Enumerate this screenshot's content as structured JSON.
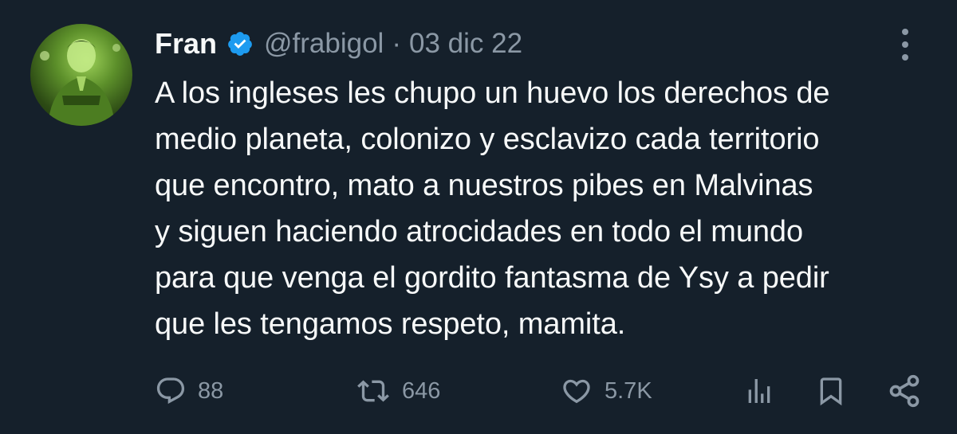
{
  "author": {
    "name": "Fran",
    "handle": "@frabigol",
    "separator": "·",
    "date": "03 dic 22"
  },
  "tweet": {
    "text": "A los ingleses les chupo un huevo los derechos de\nmedio planeta, colonizo y esclavizo cada territorio\nque encontro, mato a nuestros pibes en Malvinas\ny siguen haciendo atrocidades en todo el mundo\npara que venga el gordito fantasma de Ysy a pedir\nque les tengamos respeto, mamita."
  },
  "actions": {
    "replies": "88",
    "retweets": "646",
    "likes": "5.7K"
  },
  "colors": {
    "background": "#15202b",
    "text": "#f7f9f9",
    "secondary": "#8b98a5",
    "verified": "#1d9bf0"
  },
  "icons": [
    "avatar",
    "verified-badge-icon",
    "more-options-icon",
    "reply-icon",
    "retweet-icon",
    "like-icon",
    "views-icon",
    "bookmark-icon",
    "share-icon"
  ]
}
